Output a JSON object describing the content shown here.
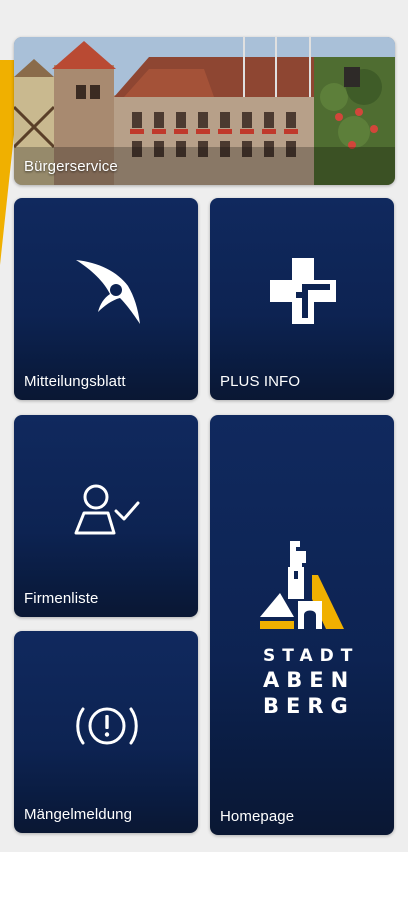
{
  "tiles": {
    "buergerservice": {
      "label": "Bürgerservice",
      "icon": "town-hall-photo"
    },
    "mitteilungsblatt": {
      "label": "Mitteilungsblatt",
      "icon": "swift-bird-icon"
    },
    "plus_info": {
      "label": "PLUS INFO",
      "icon": "plus-cross-icon"
    },
    "firmenliste": {
      "label": "Firmenliste",
      "icon": "person-check-icon"
    },
    "maengelmeldung": {
      "label": "Mängelmeldung",
      "icon": "alert-circle-icon"
    },
    "homepage": {
      "label": "Homepage",
      "icon": "stadt-abenberg-logo"
    }
  },
  "logo": {
    "line1": "STADT",
    "line2": "ABEN",
    "line3": "BERG"
  },
  "colors": {
    "tile": "#0d2352",
    "accent": "#f0b000",
    "background": "#eeeeee"
  }
}
